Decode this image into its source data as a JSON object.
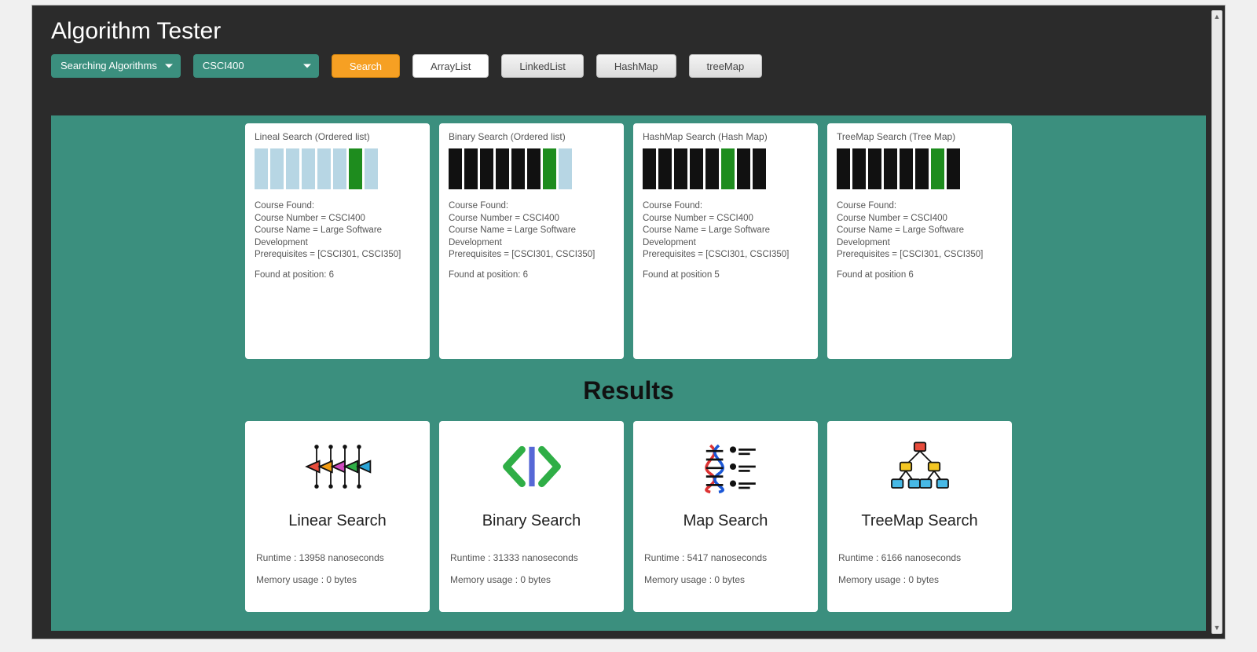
{
  "app": {
    "title": "Algorithm Tester"
  },
  "toolbar": {
    "algorithm_select": "Searching Algorithms",
    "course_select": "CSCI400",
    "search_button": "Search",
    "tab_arraylist": "ArrayList",
    "tab_linkedlist": "LinkedList",
    "tab_hashmap": "HashMap",
    "tab_treemap": "treeMap"
  },
  "visualizations": [
    {
      "title": "Lineal Search (Ordered list)",
      "bar_style": "light",
      "highlight_index": 6,
      "bar_count": 8,
      "l1": "Course Found:",
      "l2": "Course Number = CSCI400",
      "l3": "Course Name = Large Software Development",
      "l4": "Prerequisites = [CSCI301, CSCI350]",
      "found": "Found at position: 6"
    },
    {
      "title": "Binary Search (Ordered list)",
      "bar_style": "dark",
      "highlight_index": 6,
      "bar_count": 8,
      "trailing_light": true,
      "l1": "Course Found:",
      "l2": "Course Number = CSCI400",
      "l3": "Course Name = Large Software Development",
      "l4": "Prerequisites = [CSCI301, CSCI350]",
      "found": "Found at position: 6"
    },
    {
      "title": "HashMap Search (Hash Map)",
      "bar_style": "dark",
      "highlight_index": 5,
      "bar_count": 8,
      "l1": "Course Found:",
      "l2": "Course Number = CSCI400",
      "l3": "Course Name = Large Software Development",
      "l4": "Prerequisites = [CSCI301, CSCI350]",
      "found": "Found at position 5"
    },
    {
      "title": "TreeMap Search (Tree Map)",
      "bar_style": "dark",
      "highlight_index": 6,
      "bar_count": 8,
      "l1": "Course Found:",
      "l2": "Course Number = CSCI400",
      "l3": "Course Name = Large Software Development",
      "l4": "Prerequisites = [CSCI301, CSCI350]",
      "found": "Found at position 6"
    }
  ],
  "results": {
    "heading": "Results",
    "cards": [
      {
        "name": "Linear Search",
        "runtime": "Runtime :  13958 nanoseconds",
        "memory": "Memory usage :  0 bytes",
        "icon": "linear"
      },
      {
        "name": "Binary Search",
        "runtime": "Runtime :  31333 nanoseconds",
        "memory": "Memory usage :  0 bytes",
        "icon": "binary"
      },
      {
        "name": "Map Search",
        "runtime": "Runtime :  5417 nanoseconds",
        "memory": "Memory usage :  0 bytes",
        "icon": "map"
      },
      {
        "name": "TreeMap Search",
        "runtime": "Runtime :  6166 nanoseconds",
        "memory": "Memory usage :  0 bytes",
        "icon": "tree"
      }
    ]
  }
}
